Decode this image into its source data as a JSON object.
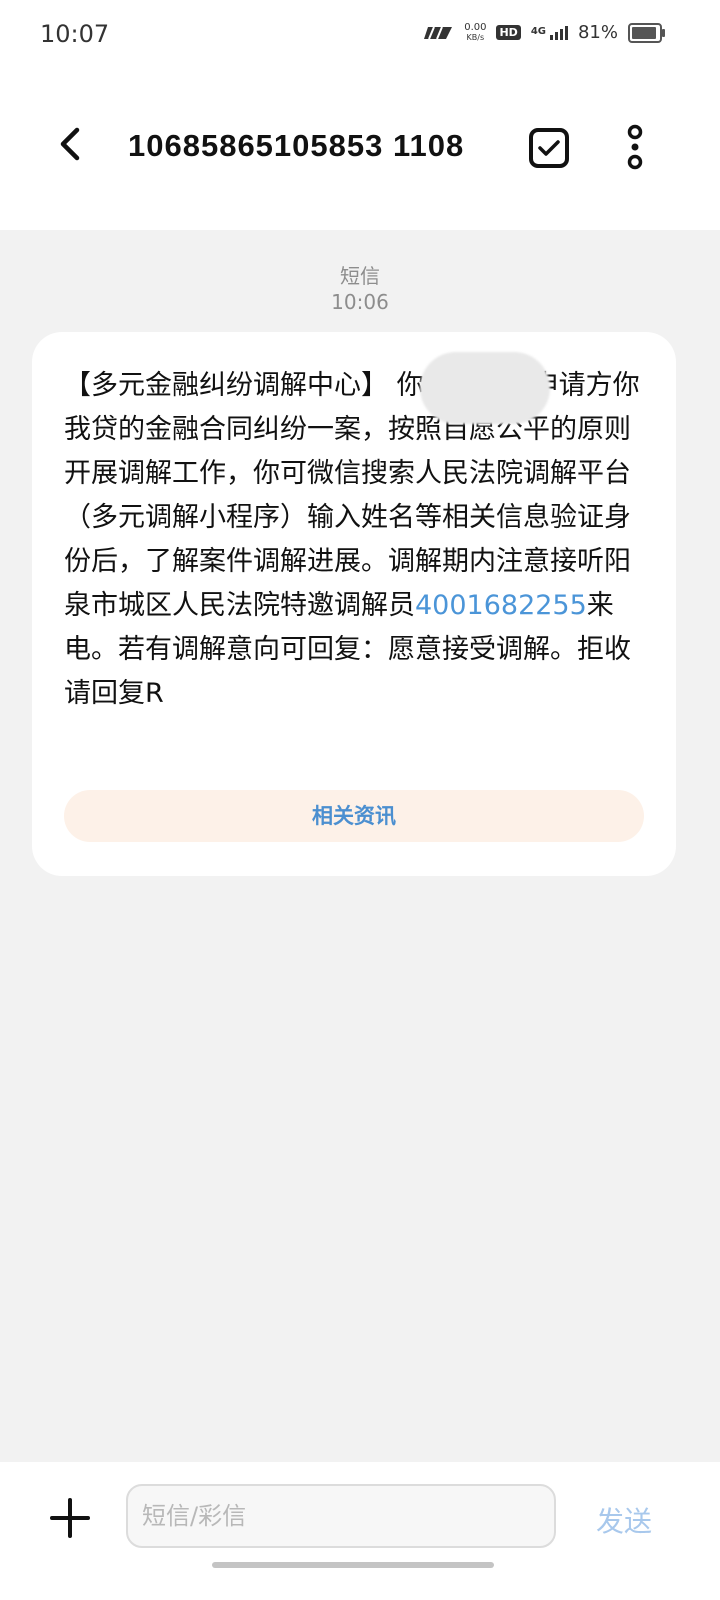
{
  "status_bar": {
    "time": "10:07",
    "net_speed_value": "0.00",
    "net_speed_unit": "KB/s",
    "hd_label": "HD",
    "network_label": "4G",
    "battery_percent": "81%",
    "battery_level": 0.81
  },
  "header": {
    "contact": "10685865105853 1108",
    "icons": [
      "back-arrow-icon",
      "checkbox-select-icon",
      "more-vertical-icon"
    ]
  },
  "thread": {
    "message_type": "短信",
    "timestamp": "10:06",
    "message": {
      "text_before_link": "【多元金融纠纷调解中心】         你好，你与申请方你我贷的金融合同纠纷一案，按照自愿公平的原则开展调解工作，你可微信搜索人民法院调解平台（多元调解小程序）输入姓名等相关信息验证身份后，了解案件调解进展。调解期内注意接听阳泉市城区人民法院特邀调解员",
      "phone_link": "4001682255",
      "text_after_link": "来电。若有调解意向可回复：愿意接受调解。拒收请回复R",
      "related_button": "相关资讯"
    }
  },
  "composer": {
    "placeholder": "短信/彩信",
    "send_label": "发送"
  },
  "colors": {
    "accent_link": "#4b95d8",
    "send_disabled": "#a8c8ec",
    "related_bg": "#fdf1e8",
    "background": "#f2f2f2"
  }
}
